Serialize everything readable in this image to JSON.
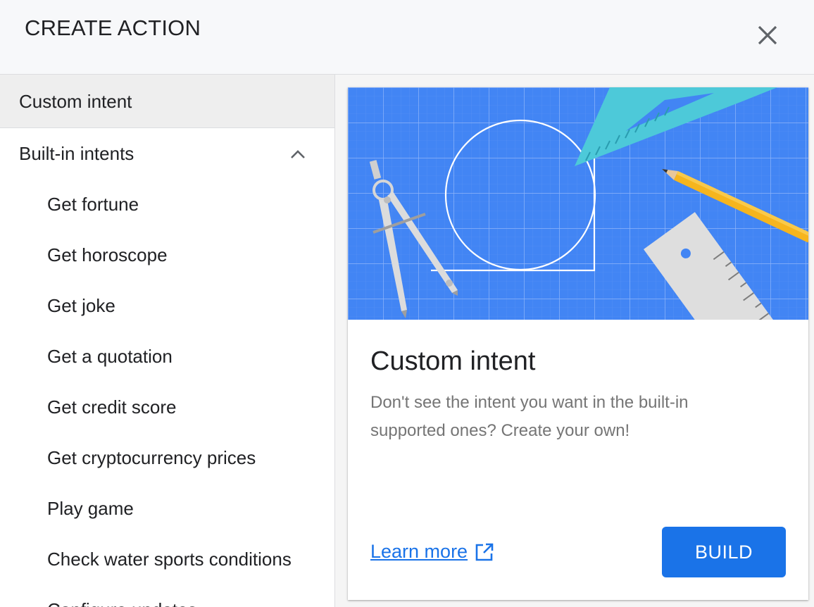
{
  "header": {
    "title": "CREATE ACTION",
    "close_icon": "close-icon"
  },
  "sidebar": {
    "custom_intent": "Custom intent",
    "builtin_group": {
      "label": "Built-in intents",
      "expanded": true,
      "toggle_icon": "chevron-up-icon"
    },
    "children": [
      "Get fortune",
      "Get horoscope",
      "Get joke",
      "Get a quotation",
      "Get credit score",
      "Get cryptocurrency prices",
      "Play game",
      "Check water sports conditions",
      "Configure updates"
    ]
  },
  "card": {
    "illustration_icon": "blueprint-tools-illustration",
    "title": "Custom intent",
    "description": "Don't see the intent you want in the built-in supported ones? Create your own!",
    "learn_more": "Learn more",
    "learn_more_icon": "open-in-new-icon",
    "build_label": "BUILD"
  },
  "colors": {
    "accent": "#1a73e8",
    "illustration_bg": "#4285f4",
    "header_bg": "#f7f8fa",
    "selected_bg": "#eeeeee"
  }
}
